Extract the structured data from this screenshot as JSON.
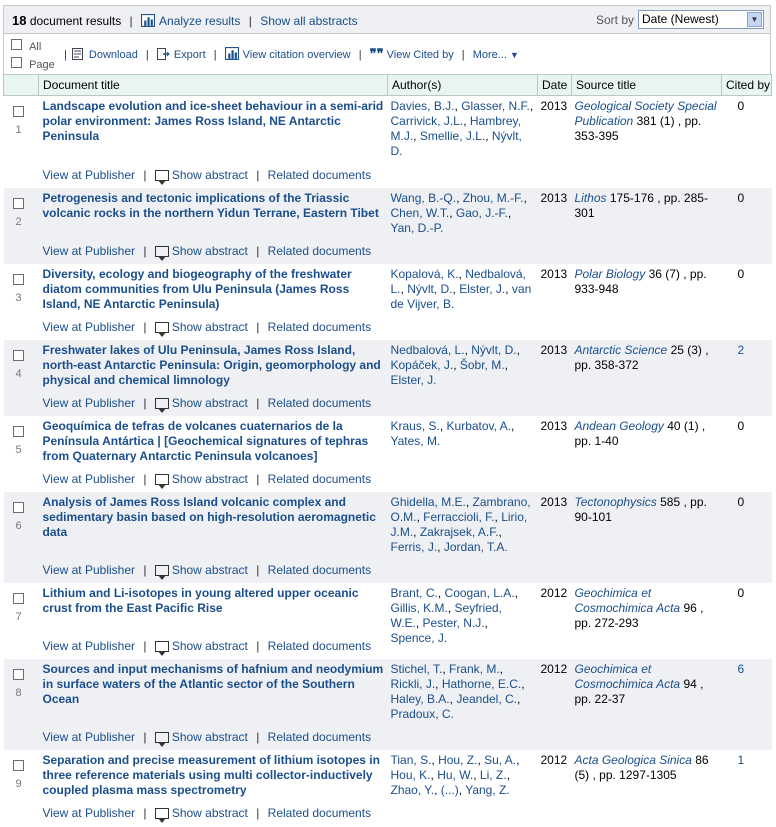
{
  "header": {
    "count": "18",
    "count_label": "document results",
    "analyze": "Analyze results",
    "show_abstracts": "Show all abstracts",
    "sort_label": "Sort by",
    "sort_value": "Date (Newest)"
  },
  "toolbar": {
    "all": "All",
    "page": "Page",
    "download": "Download",
    "export": "Export",
    "citation_overview": "View citation overview",
    "cited_by": "View Cited by",
    "more": "More..."
  },
  "columns": [
    "Document title",
    "Author(s)",
    "Date",
    "Source title",
    "Cited by"
  ],
  "actions": {
    "publisher": "View at Publisher",
    "abstract": "Show abstract",
    "related": "Related documents"
  },
  "results": [
    {
      "num": "1",
      "title": "Landscape evolution and ice-sheet behaviour in a semi-arid polar environment: James Ross Island, NE Antarctic Peninsula",
      "authors": [
        "Davies, B.J.",
        "Glasser, N.F.",
        "Carrivick, J.L.",
        "Hambrey, M.J.",
        "Smellie, J.L.",
        "Nývlt, D."
      ],
      "year": "2013",
      "source": "Geological Society Special Publication",
      "source_rest": "381 (1) , pp. 353-395",
      "cited": "0",
      "cited_link": false
    },
    {
      "num": "2",
      "title": "Petrogenesis and tectonic implications of the Triassic volcanic rocks in the northern Yidun Terrane, Eastern Tibet",
      "authors": [
        "Wang, B.-Q.",
        "Zhou, M.-F.",
        "Chen, W.T.",
        "Gao, J.-F.",
        "Yan, D.-P."
      ],
      "year": "2013",
      "source": "Lithos",
      "source_rest": "175-176 , pp. 285-301",
      "cited": "0",
      "cited_link": false
    },
    {
      "num": "3",
      "title": "Diversity, ecology and biogeography of the freshwater diatom communities from Ulu Peninsula (James Ross Island, NE Antarctic Peninsula)",
      "authors": [
        "Kopalová, K.",
        "Nedbalová, L.",
        "Nývlt, D.",
        "Elster, J.",
        "van de Vijver, B."
      ],
      "year": "2013",
      "source": "Polar Biology",
      "source_rest": "36 (7) , pp. 933-948",
      "cited": "0",
      "cited_link": false
    },
    {
      "num": "4",
      "title": "Freshwater lakes of Ulu Peninsula, James Ross Island, north-east Antarctic Peninsula: Origin, geomorphology and physical and chemical limnology",
      "authors": [
        "Nedbalová, L.",
        "Nývlt, D.",
        "Kopáček, J.",
        "Šobr, M.",
        "Elster, J."
      ],
      "year": "2013",
      "source": "Antarctic Science",
      "source_rest": "25 (3) , pp. 358-372",
      "cited": "2",
      "cited_link": true
    },
    {
      "num": "5",
      "title": "Geoquímica de tefras de volcanes cuaternarios de la Península Antártica | [Geochemical signatures of tephras from Quaternary Antarctic Peninsula volcanoes]",
      "authors": [
        "Kraus, S.",
        "Kurbatov, A.",
        "Yates, M."
      ],
      "year": "2013",
      "source": "Andean Geology",
      "source_rest": "40 (1) , pp. 1-40",
      "cited": "0",
      "cited_link": false
    },
    {
      "num": "6",
      "title": "Analysis of James Ross Island volcanic complex and sedimentary basin based on high-resolution aeromagnetic data",
      "authors": [
        "Ghidella, M.E.",
        "Zambrano, O.M.",
        "Ferraccioli, F.",
        "Lirio, J.M.",
        "Zakrajsek, A.F.",
        "Ferris, J.",
        "Jordan, T.A."
      ],
      "year": "2013",
      "source": "Tectonophysics",
      "source_rest": "585 , pp. 90-101",
      "cited": "0",
      "cited_link": false
    },
    {
      "num": "7",
      "title": "Lithium and Li-isotopes in young altered upper oceanic crust from the East Pacific Rise",
      "authors": [
        "Brant, C.",
        "Coogan, L.A.",
        "Gillis, K.M.",
        "Seyfried, W.E.",
        "Pester, N.J.",
        "Spence, J."
      ],
      "year": "2012",
      "source": "Geochimica et Cosmochimica Acta",
      "source_rest": "96 , pp. 272-293",
      "cited": "0",
      "cited_link": false
    },
    {
      "num": "8",
      "title": "Sources and input mechanisms of hafnium and neodymium in surface waters of the Atlantic sector of the Southern Ocean",
      "authors": [
        "Stichel, T.",
        "Frank, M.",
        "Rickli, J.",
        "Hathorne, E.C.",
        "Haley, B.A.",
        "Jeandel, C.",
        "Pradoux, C."
      ],
      "year": "2012",
      "source": "Geochimica et Cosmochimica Acta",
      "source_rest": "94 , pp. 22-37",
      "cited": "6",
      "cited_link": true
    },
    {
      "num": "9",
      "title": "Separation and precise measurement of lithium isotopes in three reference materials using multi collector-inductively coupled plasma mass spectrometry",
      "authors": [
        "Tian, S.",
        "Hou, Z.",
        "Su, A.",
        "Hou, K.",
        "Hu, W.",
        "Li, Z.",
        "Zhao, Y.",
        "(...)",
        "Yang, Z."
      ],
      "year": "2012",
      "source": "Acta Geologica Sinica",
      "source_rest": "86 (5) , pp. 1297-1305",
      "cited": "1",
      "cited_link": true
    }
  ]
}
